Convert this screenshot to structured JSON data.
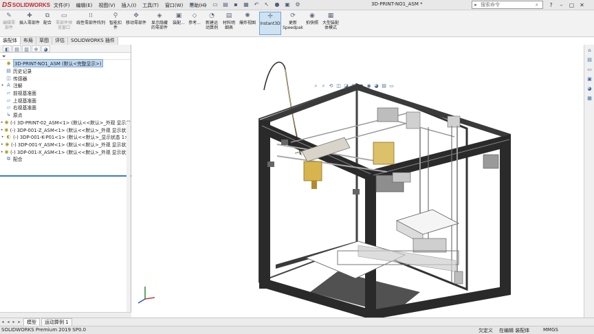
{
  "app": {
    "brand_ds": "DS",
    "brand_name": "SOLIDWORKS",
    "document_title": "3D-PRINT-NO1_ASM *",
    "search_placeholder": "搜索命令"
  },
  "menu": [
    "文件(F)",
    "编辑(E)",
    "视图(V)",
    "插入(I)",
    "工具(T)",
    "窗口(W)",
    "帮助(H)"
  ],
  "ribbon": {
    "buttons": [
      {
        "label1": "编辑零",
        "label2": "部件",
        "icon": "edit-component-icon",
        "dim": true
      },
      {
        "label1": "插入零部件",
        "label2": "",
        "icon": "insert-component-icon",
        "dim": false
      },
      {
        "label1": "配合",
        "label2": "",
        "icon": "mate-icon",
        "dim": false
      },
      {
        "label1": "零部件预",
        "label2": "览窗口",
        "icon": "preview-window-icon",
        "dim": true
      },
      {
        "label1": "线性零部件阵列",
        "label2": "",
        "icon": "linear-pattern-icon",
        "dim": false
      },
      {
        "label1": "智能扣",
        "label2": "件",
        "icon": "smart-fastener-icon",
        "dim": false
      },
      {
        "label1": "移动零部件",
        "label2": "",
        "icon": "move-component-icon",
        "dim": false
      },
      {
        "label1": "显示隐藏",
        "label2": "的零部件",
        "icon": "show-hidden-icon",
        "dim": false
      },
      {
        "label1": "装配...",
        "label2": "",
        "icon": "assembly-features-icon",
        "dim": false
      },
      {
        "label1": "参考...",
        "label2": "",
        "icon": "reference-geometry-icon",
        "dim": false
      },
      {
        "label1": "新建运",
        "label2": "动算例",
        "icon": "new-motion-study-icon",
        "dim": false
      },
      {
        "label1": "材料明",
        "label2": "细表",
        "icon": "bom-icon",
        "dim": false
      },
      {
        "label1": "爆炸视图",
        "label2": "",
        "icon": "exploded-view-icon",
        "dim": false
      },
      {
        "label1": "Instant3D",
        "label2": "",
        "icon": "instant3d-icon",
        "dim": false
      },
      {
        "label1": "更新",
        "label2": "Speedpak",
        "icon": "speedpak-icon",
        "dim": false
      },
      {
        "label1": "拍快照",
        "label2": "",
        "icon": "snapshot-icon",
        "dim": false
      },
      {
        "label1": "大型装配",
        "label2": "体模式",
        "icon": "large-assembly-icon",
        "dim": false
      }
    ]
  },
  "command_tabs": [
    "装配体",
    "布局",
    "草图",
    "评估",
    "SOLIDWORKS 插件"
  ],
  "tree": {
    "root": "3D-PRINT-NO1_ASM  (默认<完整显示>)",
    "items": [
      {
        "label": "历史记录",
        "expand": ""
      },
      {
        "label": "传感器",
        "expand": ""
      },
      {
        "label": "注解",
        "expand": "▸"
      },
      {
        "label": "前视基准面",
        "expand": ""
      },
      {
        "label": "上视基准面",
        "expand": ""
      },
      {
        "label": "右视基准面",
        "expand": ""
      },
      {
        "label": "原点",
        "expand": ""
      },
      {
        "label": "(-) 3D-PRINT-02_ASM<1> (默认<<默认>_外观 显示状",
        "expand": "▸"
      },
      {
        "label": "(-) 3DP-001-Z_ASM<1> (默认<<默认>_外观 显示状态",
        "expand": "▸"
      },
      {
        "label": "(-) 3DP-001-K-P01<1> (默认<<默认>_显示状态 1>)",
        "expand": "▸"
      },
      {
        "label": "(-) 3DP-001-Y_ASM<1> (默认<<默认>_外观 显示状态",
        "expand": "▸"
      },
      {
        "label": "(-) 3DP-001-X_ASM<1> (默认<<默认>_外观 显示状态",
        "expand": "▸"
      },
      {
        "label": "配合",
        "expand": ""
      }
    ]
  },
  "bottom_tabs": [
    "模型",
    "运动算例 1"
  ],
  "status": {
    "product": "SOLIDWORKS Premium 2019 SP0.0",
    "state": "欠定义",
    "mode": "在编辑 装配体",
    "units": "MMGS"
  }
}
